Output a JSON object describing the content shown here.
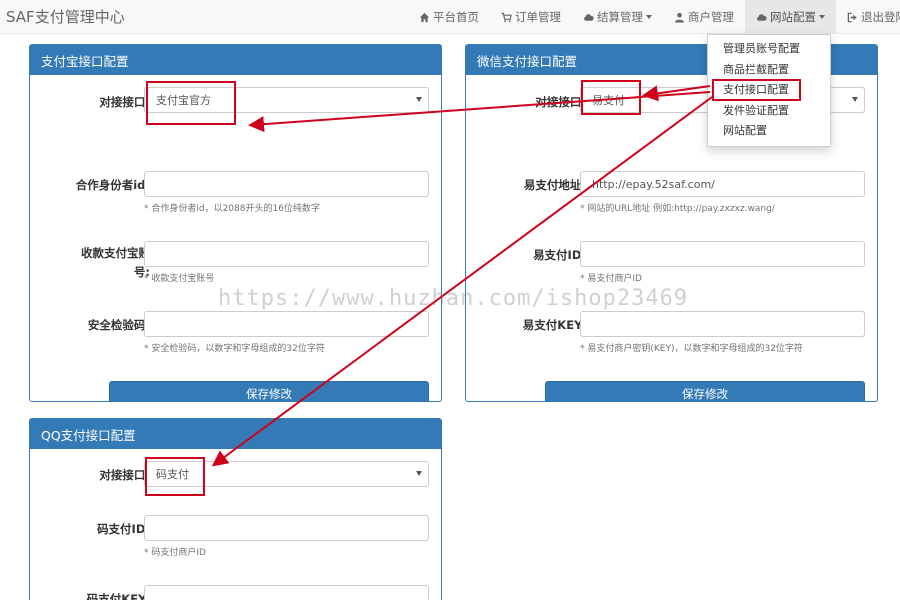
{
  "navbar": {
    "brand": "SAF支付管理中心",
    "items": [
      {
        "label": "平台首页",
        "icon": "home-icon"
      },
      {
        "label": "订单管理",
        "icon": "cart-icon"
      },
      {
        "label": "结算管理",
        "icon": "cloud-icon"
      },
      {
        "label": "商户管理",
        "icon": "user-icon"
      },
      {
        "label": "网站配置",
        "icon": "cloud-icon"
      },
      {
        "label": "退出登陆",
        "icon": "logout-icon"
      }
    ]
  },
  "dropdown": {
    "items": [
      "管理员账号配置",
      "商品拦截配置",
      "支付接口配置",
      "发件验证配置",
      "网站配置"
    ]
  },
  "alipay": {
    "title": "支付宝接口配置",
    "interface_label": "对接接口:",
    "interface_value": "支付宝官方",
    "partner_label": "合作身份者id:",
    "partner_help": "* 合作身份者id，以2088开头的16位纯数字",
    "account_label_1": "收款支付宝账",
    "account_label_2": "号:",
    "account_help": "* 收款支付宝账号",
    "key_label": "安全检验码:",
    "key_help": "* 安全检验码，以数字和字母组成的32位字符",
    "save": "保存修改"
  },
  "wechat": {
    "title": "微信支付接口配置",
    "interface_label": "对接接口:",
    "interface_value": "易支付",
    "url_label": "易支付地址:",
    "url_value": "http://epay.52saf.com/",
    "url_help": "* 网站的URL地址 例如:http://pay.zxzxz.wang/",
    "id_label": "易支付ID:",
    "id_help": "* 易支付商户ID",
    "key_label": "易支付KEY:",
    "key_help": "* 易支付商户密钥(KEY)，以数字和字母组成的32位字符",
    "save": "保存修改"
  },
  "qq": {
    "title": "QQ支付接口配置",
    "interface_label": "对接接口:",
    "interface_value": "码支付",
    "id_label": "码支付ID:",
    "id_help": "* 码支付商户ID",
    "key_label": "码支付KEY:"
  },
  "watermark": "https://www.huzhan.com/ishop23469",
  "colors": {
    "primary": "#337ab7",
    "annotation_red": "#d0021b"
  }
}
